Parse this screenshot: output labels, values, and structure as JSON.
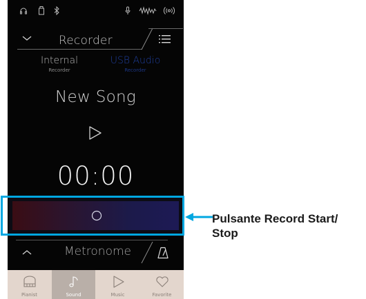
{
  "status_bar": {
    "icons": [
      "headphones-icon",
      "usb-memory-icon",
      "bluetooth-icon",
      "microphone-icon",
      "audio-wave-icon",
      "wireless-icon"
    ]
  },
  "header": {
    "title": "Recorder",
    "left_icon": "chevron-down-icon",
    "right_icon": "list-menu-icon"
  },
  "source_tabs": [
    {
      "label": "Internal",
      "sublabel": "Recorder",
      "active": false
    },
    {
      "label": "USB Audio",
      "sublabel": "Recorder",
      "active": true
    }
  ],
  "song": {
    "title": "New Song",
    "play_icon": "play-icon",
    "time": "00:00"
  },
  "record_button": {
    "icon": "record-circle-icon"
  },
  "metronome": {
    "label": "Metronome",
    "left_icon": "chevron-up-icon",
    "right_icon": "metronome-icon"
  },
  "bottom_nav": [
    {
      "label": "Pianist",
      "icon": "piano-icon",
      "active": false
    },
    {
      "label": "Sound",
      "icon": "music-note-icon",
      "active": true
    },
    {
      "label": "Music",
      "icon": "play-outline-icon",
      "active": false
    },
    {
      "label": "Favorite",
      "icon": "heart-icon",
      "active": false
    }
  ],
  "callout": {
    "text": "Pulsante Record Start/ Stop",
    "color": "#00a7e1"
  },
  "colors": {
    "accent": "#00a7e1",
    "active_tab": "#1f3f9e",
    "nav_background": "#e3d6cd"
  }
}
